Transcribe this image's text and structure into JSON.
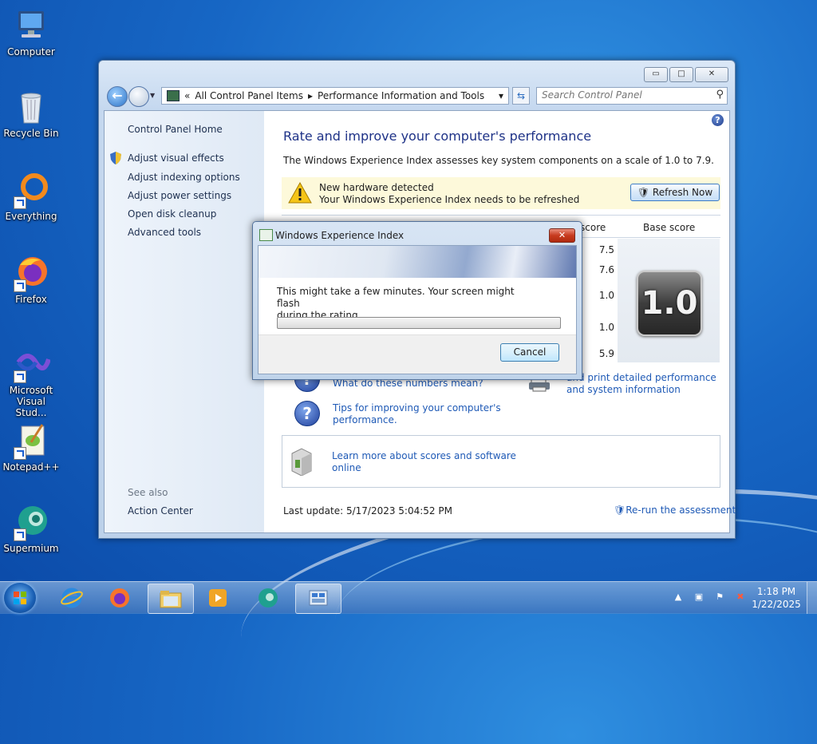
{
  "desktop": {
    "icons": [
      {
        "label": "Computer"
      },
      {
        "label": "Recycle Bin"
      },
      {
        "label": "Everything"
      },
      {
        "label": "Firefox"
      },
      {
        "label": "Microsoft Visual Studio Code"
      },
      {
        "label": "Notepad++"
      },
      {
        "label": "Supermium"
      }
    ],
    "icon_display": [
      "Computer",
      "Recycle Bin",
      "Everything",
      "Firefox",
      "Microsoft\nVisual Stud...",
      "Notepad++",
      "Supermium"
    ]
  },
  "window": {
    "caption_buttons": {
      "minimize": "▭",
      "maximize": "□",
      "close": "✕"
    },
    "address": {
      "chevron": "«",
      "crumbs": [
        "All Control Panel Items",
        "Performance Information and Tools"
      ],
      "sep": "▸",
      "dropdown": "▾"
    },
    "search_placeholder": "Search Control Panel",
    "left_pane": {
      "home": "Control Panel Home",
      "links": [
        "Adjust visual effects",
        "Adjust indexing options",
        "Adjust power settings",
        "Open disk cleanup",
        "Advanced tools"
      ],
      "see_also": "See also",
      "action_center": "Action Center"
    },
    "main": {
      "heading": "Rate and improve your computer's performance",
      "intro": "The Windows Experience Index assesses key system components on a scale of 1.0 to 7.9.",
      "notice": {
        "line1": "New hardware detected",
        "line2": "Your Windows Experience Index needs to be refreshed",
        "button": "Refresh Now"
      },
      "columns": {
        "subscore": "score",
        "base": "Base score"
      },
      "subscores": [
        "7.5",
        "7.6",
        "1.0",
        "1.0",
        "5.9"
      ],
      "base_score": "1.0",
      "links": {
        "numbers": "What do these numbers mean?",
        "tips_l1": "Tips for improving your computer's",
        "tips_l2": "performance.",
        "print_l1": "and print detailed performance",
        "print_l2": "and system information",
        "learn_l1": "Learn more about scores and software",
        "learn_l2": "online"
      },
      "last_update": "Last update: 5/17/2023 5:04:52 PM",
      "rerun": "Re-run the assessment"
    }
  },
  "dialog": {
    "title": "Windows Experience Index",
    "close": "✕",
    "message_l1": "This might take a few minutes. Your screen might flash",
    "message_l2": "during the rating.",
    "progress_fraction": 0,
    "cancel": "Cancel"
  },
  "taskbar": {
    "time": "1:18 PM",
    "date": "1/22/2025",
    "tray_arrow": "▲"
  },
  "colors": {
    "link": "#1f5ab6",
    "heading": "#1e3287",
    "notice_bg": "#fdf9da"
  }
}
